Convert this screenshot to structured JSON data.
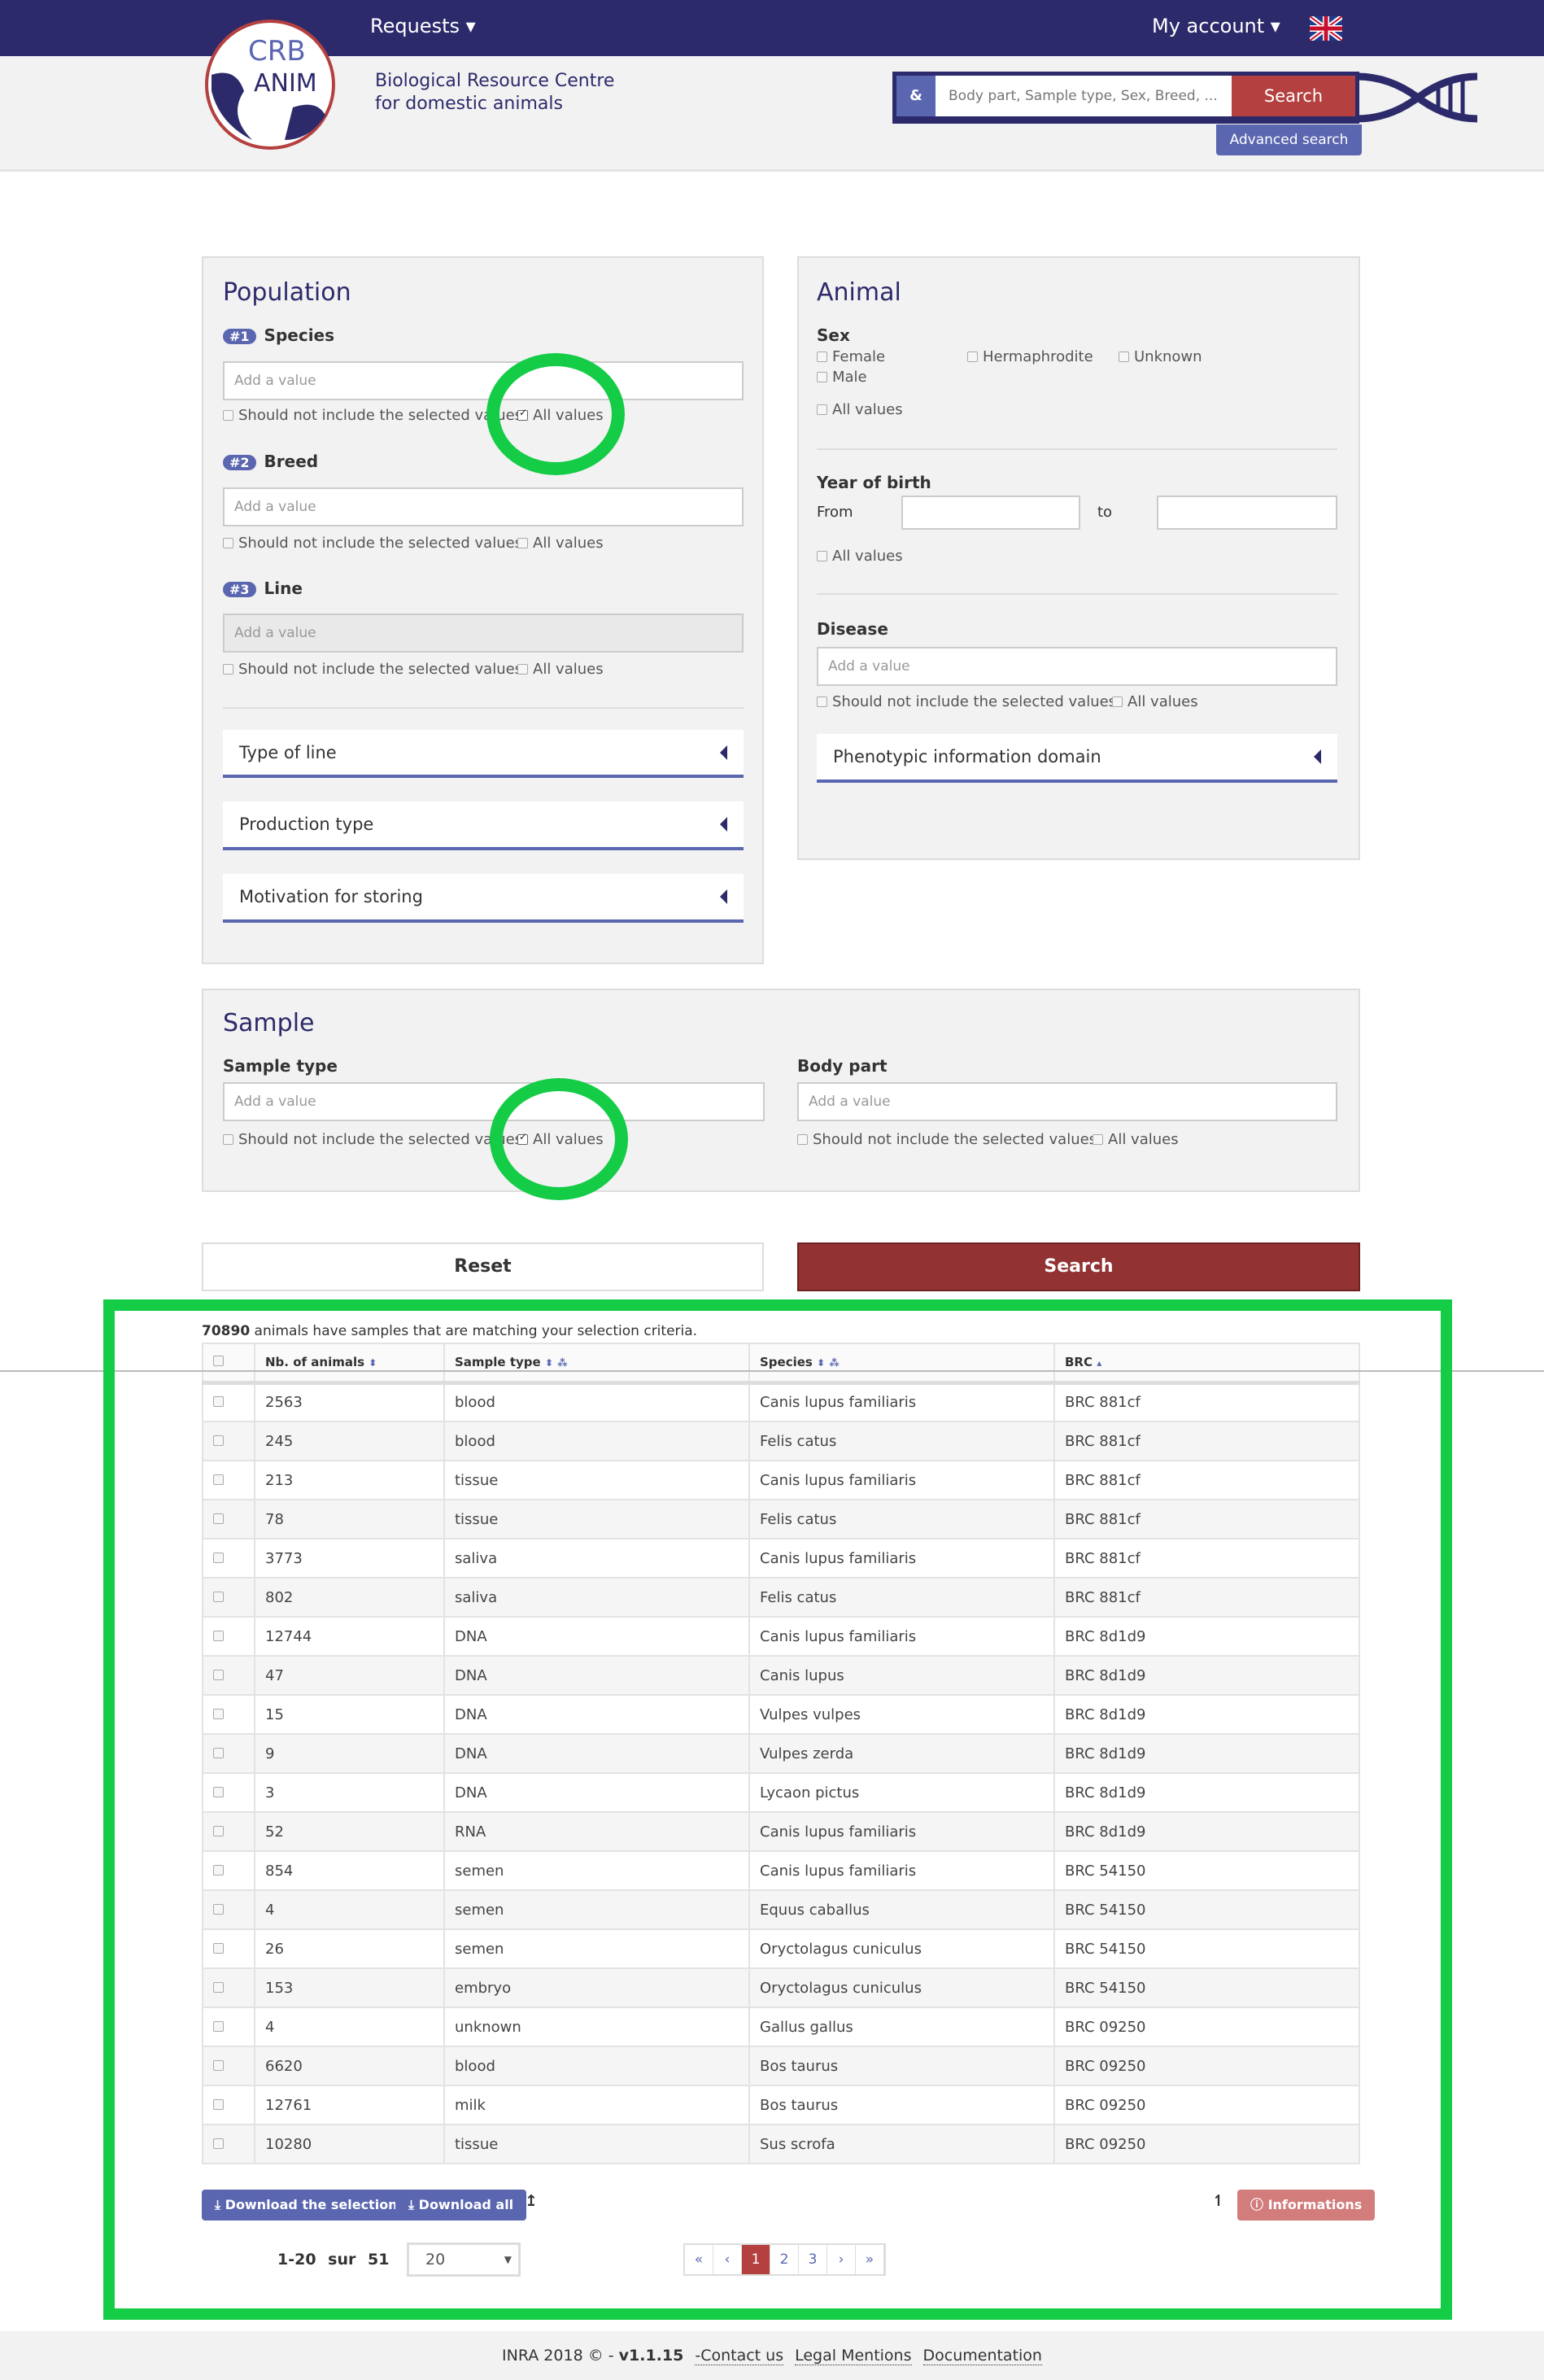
{
  "nav": {
    "requests": "Requests ▾",
    "my_account": "My account ▾",
    "flag": "uk-flag-icon"
  },
  "header": {
    "logo_text": "CRB ANIM",
    "tagline1": "Biological Resource Centre",
    "tagline2": "for domestic animals",
    "amp": "&",
    "search_placeholder": "Body part, Sample type, Sex, Breed, ...",
    "search": "Search",
    "advanced": "Advanced search"
  },
  "population": {
    "title": "Population",
    "species": {
      "num": "#1",
      "label": "Species"
    },
    "breed": {
      "num": "#2",
      "label": "Breed"
    },
    "line": {
      "num": "#3",
      "label": "Line"
    },
    "placeholder": "Add a value",
    "exclude": "Should not include the selected values",
    "all": "All values",
    "type_of_line": "Type of line",
    "production_type": "Production type",
    "motivation": "Motivation for storing"
  },
  "animal": {
    "title": "Animal",
    "sex": "Sex",
    "female": "Female",
    "male": "Male",
    "hermaphrodite": "Hermaphrodite",
    "unknown": "Unknown",
    "all": "All values",
    "year": "Year of birth",
    "from": "From",
    "to": "to",
    "disease": "Disease",
    "placeholder": "Add a value",
    "exclude": "Should not include the selected values",
    "phenotypic": "Phenotypic information domain"
  },
  "sample": {
    "title": "Sample",
    "sample_type": "Sample type",
    "body_part": "Body part",
    "placeholder": "Add a value",
    "exclude": "Should not include the selected values",
    "all": "All values"
  },
  "actions": {
    "reset": "Reset",
    "search": "Search"
  },
  "results": {
    "count": "70890",
    "text": " animals have samples that are matching your selection criteria.",
    "columns": [
      "Nb. of animals",
      "Sample type",
      "Species",
      "BRC"
    ],
    "rows": [
      [
        "2563",
        "blood",
        "Canis lupus familiaris",
        "BRC 881cf"
      ],
      [
        "245",
        "blood",
        "Felis catus",
        "BRC 881cf"
      ],
      [
        "213",
        "tissue",
        "Canis lupus familiaris",
        "BRC 881cf"
      ],
      [
        "78",
        "tissue",
        "Felis catus",
        "BRC 881cf"
      ],
      [
        "3773",
        "saliva",
        "Canis lupus familiaris",
        "BRC 881cf"
      ],
      [
        "802",
        "saliva",
        "Felis catus",
        "BRC 881cf"
      ],
      [
        "12744",
        "DNA",
        "Canis lupus familiaris",
        "BRC 8d1d9"
      ],
      [
        "47",
        "DNA",
        "Canis lupus",
        "BRC 8d1d9"
      ],
      [
        "15",
        "DNA",
        "Vulpes vulpes",
        "BRC 8d1d9"
      ],
      [
        "9",
        "DNA",
        "Vulpes zerda",
        "BRC 8d1d9"
      ],
      [
        "3",
        "DNA",
        "Lycaon pictus",
        "BRC 8d1d9"
      ],
      [
        "52",
        "RNA",
        "Canis lupus familiaris",
        "BRC 8d1d9"
      ],
      [
        "854",
        "semen",
        "Canis lupus familiaris",
        "BRC 54150"
      ],
      [
        "4",
        "semen",
        "Equus caballus",
        "BRC 54150"
      ],
      [
        "26",
        "semen",
        "Oryctolagus cuniculus",
        "BRC 54150"
      ],
      [
        "153",
        "embryo",
        "Oryctolagus cuniculus",
        "BRC 54150"
      ],
      [
        "4",
        "unknown",
        "Gallus gallus",
        "BRC 09250"
      ],
      [
        "6620",
        "blood",
        "Bos taurus",
        "BRC 09250"
      ],
      [
        "12761",
        "milk",
        "Bos taurus",
        "BRC 09250"
      ],
      [
        "10280",
        "tissue",
        "Sus scrofa",
        "BRC 09250"
      ]
    ],
    "download_selection": "Download the selection",
    "download_all": "Download all",
    "informations": "Informations",
    "range": "1-20",
    "sur": "sur",
    "total": "51",
    "page_size": "20",
    "pages": [
      "«",
      "‹",
      "1",
      "2",
      "3",
      "›",
      "»"
    ],
    "current_page": "1"
  },
  "footer": {
    "copy": "INRA 2018 © - ",
    "version": "v1.1.15",
    "contact": "-Contact us",
    "legal": "Legal Mentions",
    "docs": "Documentation"
  },
  "colors": {
    "navy": "#2c2a6b",
    "accent": "#5a66b0",
    "red": "#b44040",
    "highlight": "#14cc46"
  }
}
